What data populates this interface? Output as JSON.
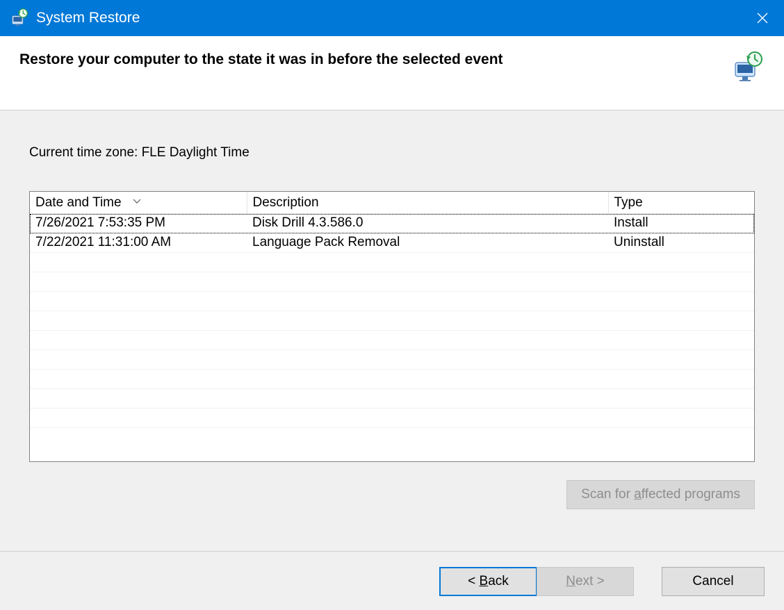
{
  "window": {
    "title": "System Restore"
  },
  "header": {
    "heading": "Restore your computer to the state it was in before the selected event"
  },
  "timezone_label": "Current time zone: FLE Daylight Time",
  "table": {
    "columns": {
      "date": "Date and Time",
      "desc": "Description",
      "type": "Type"
    },
    "rows": [
      {
        "date": "7/26/2021 7:53:35 PM",
        "desc": "Disk Drill 4.3.586.0",
        "type": "Install"
      },
      {
        "date": "7/22/2021 11:31:00 AM",
        "desc": "Language Pack Removal",
        "type": "Uninstall"
      }
    ]
  },
  "buttons": {
    "scan_prefix": "Scan for ",
    "scan_u": "a",
    "scan_suffix": "ffected programs",
    "back_prefix": "< ",
    "back_u": "B",
    "back_suffix": "ack",
    "next_u": "N",
    "next_suffix": "ext >",
    "cancel": "Cancel"
  }
}
